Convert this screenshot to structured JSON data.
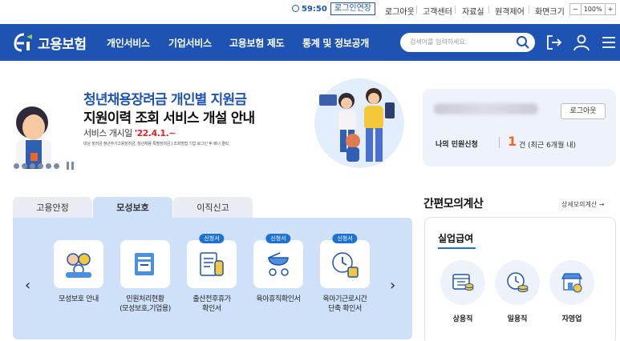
{
  "util": {
    "timer": "59:50",
    "extend_label": "로그인연장",
    "links": [
      "로그아웃",
      "고객센터",
      "자료실",
      "원격제어",
      "화면크기"
    ],
    "zoom": {
      "minus": "−",
      "value": "100%",
      "plus": "+"
    }
  },
  "header": {
    "logo_text": "고용보험",
    "menu": [
      "개인서비스",
      "기업서비스",
      "고용보험 제도",
      "통계 및 정보공개"
    ],
    "search_placeholder": "검색어를 입력하세요."
  },
  "banner": {
    "title_line1": "청년채용장려금 개인별 지원금",
    "title_line2": "지원이력 조회 서비스 개설 안내",
    "open_label": "서비스 개시일",
    "open_date": "'22.4.1.~",
    "detail": "대상 장려금 청년추가고용장려금, 청년채용 특별장려금 | 조회방법 기업 로그인 후 배너 클릭",
    "dot_count": 6
  },
  "user_panel": {
    "logout_label": "로그아웃",
    "my_label": "나의 민원신청",
    "count": "1",
    "count_suffix": "건 (최근 6개월 내)"
  },
  "tabs": [
    "고용안정",
    "모성보호",
    "이직신고"
  ],
  "active_tab": "모성보호",
  "services": [
    {
      "label": "모성보호 안내",
      "badge": ""
    },
    {
      "label": "민원처리현황\n(모성보호,기업용)",
      "badge": ""
    },
    {
      "label": "출산전후휴가\n확인서",
      "badge": "신청서"
    },
    {
      "label": "육아휴직확인서",
      "badge": "신청서"
    },
    {
      "label": "육아기근로시간\n단축 확인서",
      "badge": "신청서"
    }
  ],
  "calc": {
    "title": "간편모의계산",
    "more": "상세모의계산 →",
    "card_title": "실업급여",
    "items": [
      "상용직",
      "일용직",
      "자영업"
    ]
  },
  "colors": {
    "brand": "#1e53b3",
    "accent": "#e0242b",
    "orange": "#f26522",
    "tab_bg": "#cfe1f8"
  }
}
